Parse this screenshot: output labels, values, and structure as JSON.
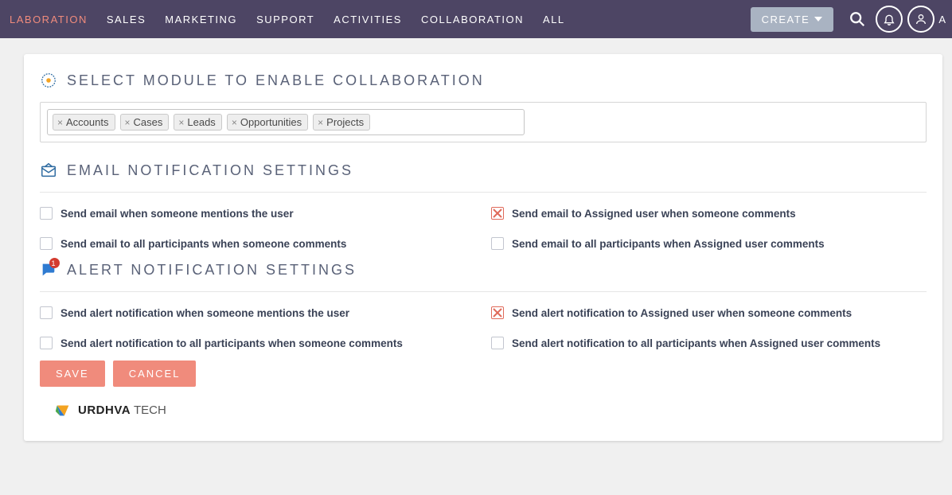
{
  "nav": {
    "items": [
      {
        "label": "LABORATION",
        "active": true
      },
      {
        "label": "SALES"
      },
      {
        "label": "MARKETING"
      },
      {
        "label": "SUPPORT"
      },
      {
        "label": "ACTIVITIES"
      },
      {
        "label": "COLLABORATION"
      },
      {
        "label": "ALL"
      }
    ],
    "create": "CREATE",
    "avatar_initial": "A"
  },
  "sections": {
    "module_title": "SELECT MODULE TO ENABLE COLLABORATION",
    "email_title": "EMAIL NOTIFICATION SETTINGS",
    "alert_title": "ALERT NOTIFICATION SETTINGS",
    "alert_badge": "1"
  },
  "modules": [
    "Accounts",
    "Cases",
    "Leads",
    "Opportunities",
    "Projects"
  ],
  "email_settings": [
    {
      "label": "Send email when someone mentions the user",
      "checked": false
    },
    {
      "label": "Send email to Assigned user when someone comments",
      "checked": true
    },
    {
      "label": "Send email to all participants when someone comments",
      "checked": false
    },
    {
      "label": "Send email to all participants when Assigned user comments",
      "checked": false
    }
  ],
  "alert_settings": [
    {
      "label": "Send alert notification when someone mentions the user",
      "checked": false
    },
    {
      "label": "Send alert notification to Assigned user when someone comments",
      "checked": true
    },
    {
      "label": "Send alert notification to all participants when someone comments",
      "checked": false
    },
    {
      "label": "Send alert notification to all participants when Assigned user comments",
      "checked": false
    }
  ],
  "actions": {
    "save": "SAVE",
    "cancel": "CANCEL"
  },
  "footer": {
    "brand_bold": "URDHVA",
    "brand_light": " TECH"
  }
}
